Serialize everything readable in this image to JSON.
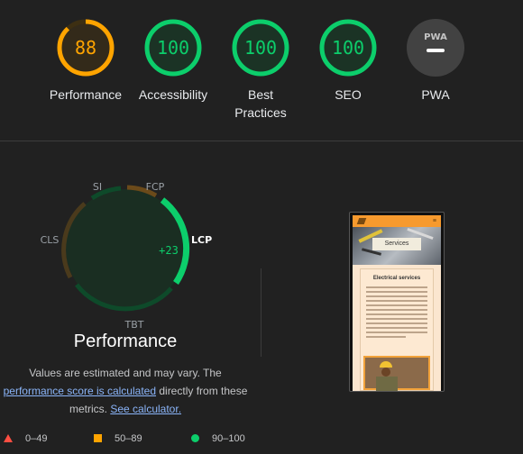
{
  "colors": {
    "pass": "#0cce6b",
    "average": "#ffa400",
    "fail": "#ff4e42",
    "na": "#424242"
  },
  "gauges": [
    {
      "id": "performance",
      "score": "88",
      "score_value": 88,
      "label": "Performance",
      "status": "average"
    },
    {
      "id": "accessibility",
      "score": "100",
      "score_value": 100,
      "label": "Accessibility",
      "status": "pass"
    },
    {
      "id": "best-practices",
      "score": "100",
      "score_value": 100,
      "label_line1": "Best",
      "label_line2": "Practices",
      "status": "pass"
    },
    {
      "id": "seo",
      "score": "100",
      "score_value": 100,
      "label": "SEO",
      "status": "pass"
    },
    {
      "id": "pwa",
      "badge": "PWA",
      "label": "PWA",
      "status": "na"
    }
  ],
  "metric_gauge": {
    "metrics": [
      "SI",
      "FCP",
      "LCP",
      "TBT",
      "CLS"
    ],
    "lcp_delta": "+23",
    "title": "Performance"
  },
  "note": {
    "line1": "Values are estimated and may vary. The",
    "link1": "performance score is calculated",
    "line2_rest": " directly from these",
    "line3_start": "metrics. ",
    "link2": "See calculator."
  },
  "screenshot": {
    "hero_caption": "Services",
    "card_heading": "Electrical services",
    "menu_icon": "hamburger-icon"
  },
  "legend": [
    {
      "shape": "triangle",
      "range": "0–49"
    },
    {
      "shape": "square",
      "range": "50–89"
    },
    {
      "shape": "circle",
      "range": "90–100"
    }
  ]
}
